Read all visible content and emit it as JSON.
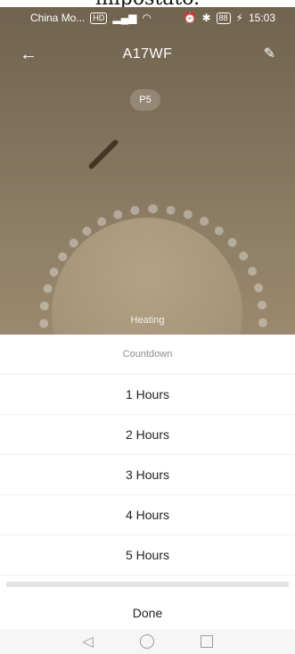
{
  "page_fragment_text": "impostato.",
  "status_bar": {
    "carrier": "China Mo...",
    "hd_label": "HD",
    "battery": "88",
    "time": "15:03"
  },
  "header": {
    "title": "A17WF",
    "back_icon": "arrow-left-icon",
    "edit_icon": "pencil-icon"
  },
  "device": {
    "mode_badge": "P5",
    "status_text": "Heating"
  },
  "countdown_sheet": {
    "title": "Countdown",
    "options": [
      "1 Hours",
      "2 Hours",
      "3 Hours",
      "4 Hours",
      "5 Hours"
    ],
    "done_label": "Done"
  },
  "nav": {
    "back_icon": "triangle-back-icon",
    "home_icon": "circle-home-icon",
    "recents_icon": "square-recents-icon"
  }
}
